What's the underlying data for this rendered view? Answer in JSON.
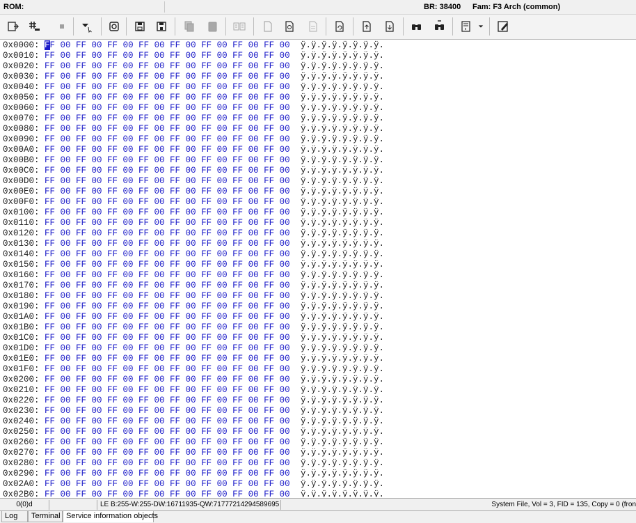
{
  "infobar": {
    "rom_label": "ROM:",
    "br_label": "BR: 38400",
    "fam_label": "Fam: F3 Arch (common)"
  },
  "toolbar": {
    "buttons": [
      {
        "icon": "open-file-icon"
      },
      {
        "icon": "hash-icon"
      },
      {
        "icon": "stop-icon"
      },
      {
        "icon": "dropdown-arrow-icon"
      },
      {
        "icon": "chip-read-icon"
      },
      {
        "icon": "save-floppy-icon"
      },
      {
        "icon": "save-as-floppy-icon"
      },
      {
        "icon": "copy-icon"
      },
      {
        "icon": "paste-icon"
      },
      {
        "icon": "compare-icon"
      },
      {
        "icon": "document-icon"
      },
      {
        "icon": "document-settings-icon"
      },
      {
        "icon": "document-text-icon"
      },
      {
        "icon": "refresh-document-icon"
      },
      {
        "icon": "upload-icon"
      },
      {
        "icon": "download-icon"
      },
      {
        "icon": "find-icon"
      },
      {
        "icon": "find-next-icon"
      },
      {
        "icon": "script-icon"
      },
      {
        "icon": "edit-icon"
      }
    ]
  },
  "hex": {
    "byte_pair": "FF 00 FF 00 FF 00 FF 00 FF 00 FF 00 FF 00 FF 00",
    "ascii": "ÿ.ÿ.ÿ.ÿ.ÿ.ÿ.ÿ.ÿ.",
    "rows": [
      "0x0000:",
      "0x0010:",
      "0x0020:",
      "0x0030:",
      "0x0040:",
      "0x0050:",
      "0x0060:",
      "0x0070:",
      "0x0080:",
      "0x0090:",
      "0x00A0:",
      "0x00B0:",
      "0x00C0:",
      "0x00D0:",
      "0x00E0:",
      "0x00F0:",
      "0x0100:",
      "0x0110:",
      "0x0120:",
      "0x0130:",
      "0x0140:",
      "0x0150:",
      "0x0160:",
      "0x0170:",
      "0x0180:",
      "0x0190:",
      "0x01A0:",
      "0x01B0:",
      "0x01C0:",
      "0x01D0:",
      "0x01E0:",
      "0x01F0:",
      "0x0200:",
      "0x0210:",
      "0x0220:",
      "0x0230:",
      "0x0240:",
      "0x0250:",
      "0x0260:",
      "0x0270:",
      "0x0280:",
      "0x0290:",
      "0x02A0:",
      "0x02B0:"
    ]
  },
  "status": {
    "position": "0(0)d",
    "values": "LE B:255-W:255-DW:16711935-QW:71777214294589695",
    "file_info": "System File, Vol = 3, FID = 135, Copy = 0 (fron"
  },
  "tabs": [
    {
      "label": "Log"
    },
    {
      "label": "Terminal"
    },
    {
      "label": "Service information objects"
    }
  ]
}
